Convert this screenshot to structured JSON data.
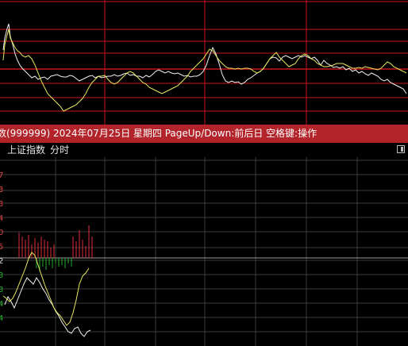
{
  "status_bar": {
    "text": "数(999999) 2024年07月25日 星期四 PageUp/Down:前后日 空格键:操作"
  },
  "tabs": {
    "index_label": "上证指数",
    "time_label": "分时"
  },
  "icons": {
    "expand": "expand-icon"
  },
  "colors": {
    "status_bar_bg": "#b3242a",
    "grid_top": "#c8141a",
    "grid_bottom": "#3a3a3a",
    "line_white": "#f0f0f0",
    "line_yellow": "#e8e860",
    "bar_up": "#e0303a",
    "bar_down": "#22b030"
  },
  "bottom_axis_labels": {
    "values": [
      "7",
      "3",
      "3",
      "4",
      "0",
      "5",
      "2",
      "3",
      "3",
      "4",
      "4"
    ],
    "colors": [
      "#e04040",
      "#e04040",
      "#e04040",
      "#e04040",
      "#e04040",
      "#e04040",
      "#e0e0e0",
      "#22b030",
      "#22b030",
      "#22b030",
      "#22b030"
    ]
  }
}
